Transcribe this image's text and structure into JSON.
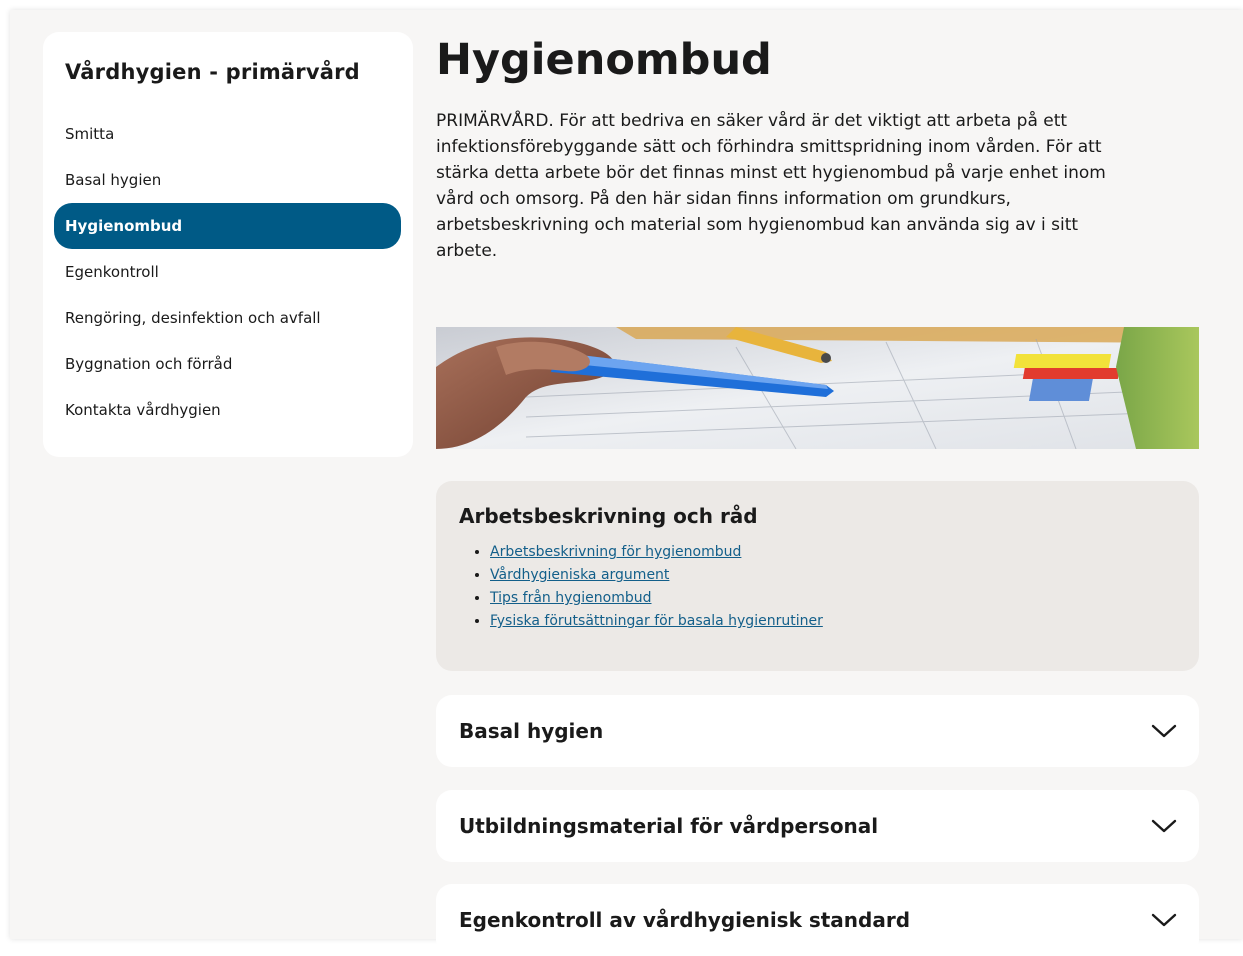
{
  "sidebar": {
    "title": "Vårdhygien - primärvård",
    "items": [
      {
        "label": "Smitta",
        "active": false
      },
      {
        "label": "Basal hygien",
        "active": false
      },
      {
        "label": "Hygienombud",
        "active": true
      },
      {
        "label": "Egenkontroll",
        "active": false
      },
      {
        "label": "Rengöring, desinfektion och avfall",
        "active": false
      },
      {
        "label": "Byggnation och förråd",
        "active": false
      },
      {
        "label": "Kontakta vårdhygien",
        "active": false
      }
    ]
  },
  "main": {
    "title": "Hygienombud",
    "intro": "PRIMÄRVÅRD. För att bedriva en säker vård är det viktigt att arbeta på ett infektionsförebyggande sätt och förhindra smittspridning inom vården. För att stärka detta arbete bör det finnas minst ett hygienombud på varje enhet inom vård och omsorg. På den här sidan finns  information om grundkurs, arbetsbeskrivning och material som hygienombud kan använda sig av i sitt arbete.",
    "card": {
      "title": "Arbetsbeskrivning och råd",
      "links": [
        "Arbetsbeskrivning för hygienombud",
        "Vårdhygieniska argument",
        "Tips från hygienombud",
        "Fysiska förutsättningar för basala hygienrutiner"
      ]
    },
    "accordions": [
      {
        "label": "Basal hygien",
        "icon": "chevron-down-icon"
      },
      {
        "label": "Utbildningsmaterial för vårdpersonal",
        "icon": "chevron-down-icon"
      },
      {
        "label": "Egenkontroll av vårdhygienisk standard",
        "icon": "chevron-down-icon"
      }
    ]
  },
  "colors": {
    "accent": "#005a86",
    "link": "#135f8a",
    "card_bg": "#ece9e6",
    "page_bg": "#f7f6f5"
  }
}
